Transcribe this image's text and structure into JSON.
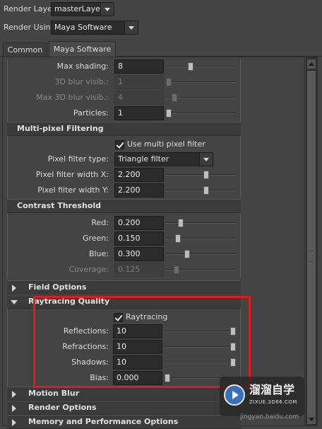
{
  "render_layer": {
    "label": "Render Layer",
    "value": "masterLayer"
  },
  "render_using": {
    "label": "Render Using",
    "value": "Maya Software"
  },
  "tabs": [
    {
      "label": "Common"
    },
    {
      "label": "Maya Software"
    }
  ],
  "top_group": {
    "max_shading": {
      "label": "Max shading:",
      "value": "8"
    },
    "blur_visib_3d": {
      "label": "3D blur visib.:",
      "value": "1"
    },
    "max_blur_visib_3d": {
      "label": "Max 3D blur visib.:",
      "value": "4"
    },
    "particles": {
      "label": "Particles:",
      "value": "1"
    }
  },
  "multipixel": {
    "title": "Multi-pixel Filtering",
    "use_filter_label": "Use multi pixel filter",
    "filter_type": {
      "label": "Pixel filter type:",
      "value": "Triangle filter"
    },
    "width_x": {
      "label": "Pixel filter width X:",
      "value": "2.200"
    },
    "width_y": {
      "label": "Pixel filter width Y:",
      "value": "2.200"
    }
  },
  "contrast": {
    "title": "Contrast Threshold",
    "red": {
      "label": "Red:",
      "value": "0.200"
    },
    "green": {
      "label": "Green:",
      "value": "0.150"
    },
    "blue": {
      "label": "Blue:",
      "value": "0.300"
    },
    "coverage": {
      "label": "Coverage:",
      "value": "0.125"
    }
  },
  "field_options": {
    "title": "Field Options"
  },
  "raytracing": {
    "title": "Raytracing Quality",
    "checkbox_label": "Raytracing",
    "reflections": {
      "label": "Reflections:",
      "value": "10"
    },
    "refractions": {
      "label": "Refractions:",
      "value": "10"
    },
    "shadows": {
      "label": "Shadows:",
      "value": "10"
    },
    "bias": {
      "label": "Bias:",
      "value": "0.000"
    }
  },
  "motion_blur": {
    "title": "Motion Blur"
  },
  "render_options": {
    "title": "Render Options"
  },
  "memory": {
    "title": "Memory and Performance Options"
  },
  "watermark": {
    "brand": "溜溜自学",
    "url": "ZIXUE.3D66.COM",
    "partial": "jingyan.baidu.com"
  },
  "colors": {
    "highlight_box": "#e01b1b",
    "panel_bg": "#444444",
    "field_bg": "#2b2b2b"
  }
}
